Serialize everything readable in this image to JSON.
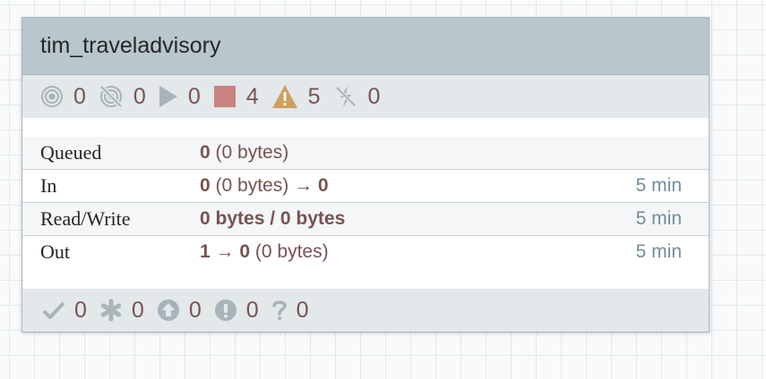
{
  "process_group": {
    "name": "tim_traveladvisory",
    "status": {
      "transmitting": "0",
      "not_transmitting": "0",
      "running": "0",
      "stopped": "4",
      "invalid": "5",
      "disabled": "0"
    },
    "stats": {
      "queued": {
        "label": "Queued",
        "count": "0",
        "size": "(0 bytes)"
      },
      "in": {
        "label": "In",
        "count": "0",
        "size": "(0 bytes)",
        "arrow": "→",
        "target": "0",
        "time": "5 min"
      },
      "read_write": {
        "label": "Read/Write",
        "value": "0 bytes / 0 bytes",
        "time": "5 min"
      },
      "out": {
        "label": "Out",
        "count": "1",
        "arrow": "→",
        "target": "0",
        "size": "(0 bytes)",
        "time": "5 min"
      }
    },
    "versioning": {
      "up_to_date": "0",
      "locally_modified": "0",
      "stale": "0",
      "locally_modified_and_stale": "0",
      "sync_failure": "0"
    }
  },
  "colors": {
    "header_bg": "#b8c6cd",
    "bar_bg": "#e3e8eb",
    "count_text": "#775351",
    "icon_gray": "#a8b3ba",
    "stopped_red": "#c88380",
    "warning_orange": "#cf9f5d",
    "time_text": "#728e9b"
  }
}
